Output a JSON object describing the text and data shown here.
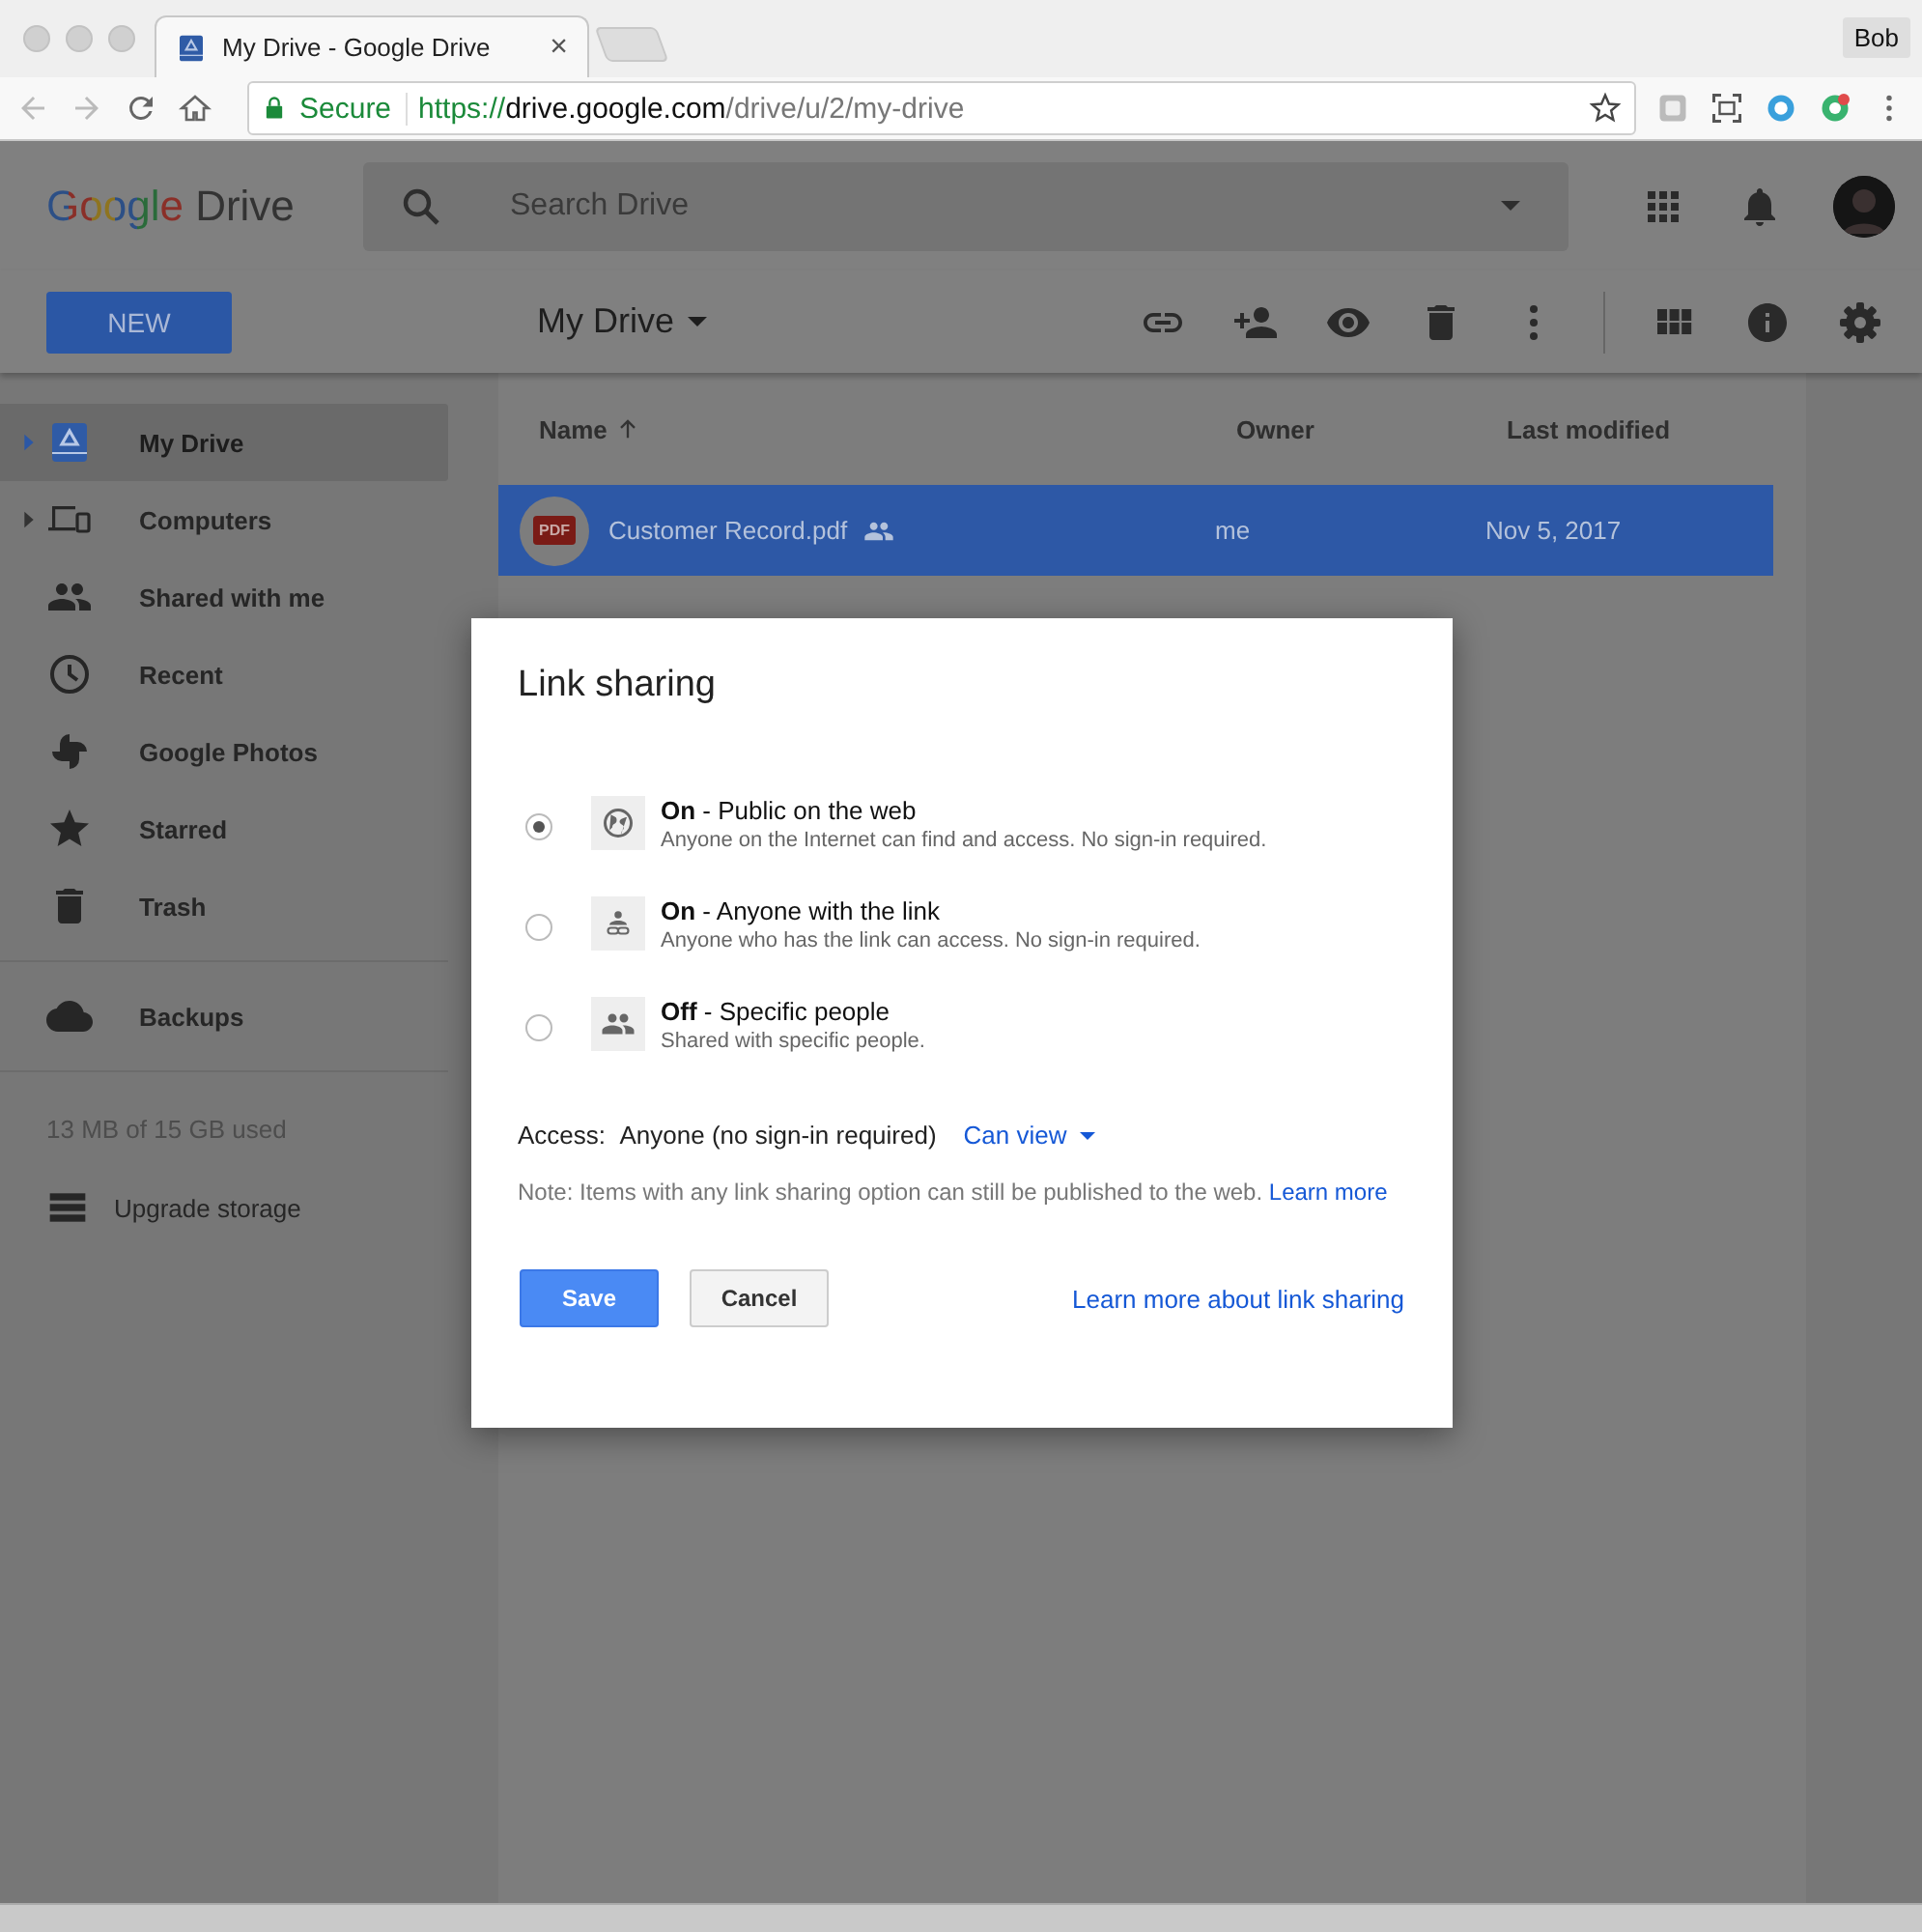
{
  "browser": {
    "tab_title": "My Drive - Google Drive",
    "tab_close": "×",
    "secure_label": "Secure",
    "url_scheme": "https://",
    "url_host": "drive.google.com",
    "url_path": "/drive/u/2/my-drive",
    "profile": "Bob"
  },
  "header": {
    "logo_word": "Google",
    "product": "Drive",
    "search_placeholder": "Search Drive"
  },
  "toolbar": {
    "new_button": "NEW",
    "title": "My Drive"
  },
  "sidebar": {
    "items": [
      {
        "label": "My Drive",
        "expandable": true,
        "selected": true
      },
      {
        "label": "Computers",
        "expandable": true,
        "selected": false
      },
      {
        "label": "Shared with me",
        "expandable": false,
        "selected": false
      },
      {
        "label": "Recent",
        "expandable": false,
        "selected": false
      },
      {
        "label": "Google Photos",
        "expandable": false,
        "selected": false
      },
      {
        "label": "Starred",
        "expandable": false,
        "selected": false
      },
      {
        "label": "Trash",
        "expandable": false,
        "selected": false
      }
    ],
    "extra_items": [
      {
        "label": "Backups"
      }
    ],
    "storage": "13 MB of 15 GB used",
    "upgrade": "Upgrade storage"
  },
  "table": {
    "columns": [
      {
        "label": "Name",
        "sorted": true
      },
      {
        "label": "Owner",
        "sorted": false
      },
      {
        "label": "Last modified",
        "sorted": false
      }
    ],
    "rows": [
      {
        "badge": "PDF",
        "name": "Customer Record.pdf",
        "shared": true,
        "owner": "me",
        "modified": "Nov 5, 2017",
        "selected": true
      }
    ]
  },
  "dialog": {
    "title": "Link sharing",
    "options": [
      {
        "title": "**On** - Public on the web",
        "description": "Anyone on the Internet can find and access. No sign-in required.",
        "selected": true
      },
      {
        "title": "**On** - Anyone with the link",
        "description": "Anyone who has the link can access. No sign-in required.",
        "selected": false
      },
      {
        "title": "**Off** - Specific people",
        "description": "Shared with specific people.",
        "selected": false
      }
    ],
    "access_label": "Access:",
    "access_value": "Anyone (no sign-in required)",
    "permission": "Can view",
    "note": "Note: Items with any link sharing option can still be published to the web.",
    "note_link": "Learn more",
    "save": "Save",
    "cancel": "Cancel",
    "help_link": "Learn more about link sharing"
  }
}
